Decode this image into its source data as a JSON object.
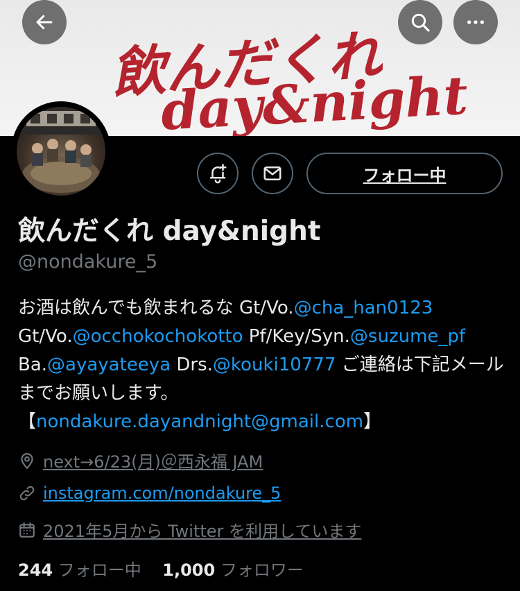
{
  "header": {
    "banner_line1": "飲んだくれ",
    "banner_line2": "day&night",
    "banner_color": "#b5242e",
    "back_icon": "arrow-left-icon",
    "search_icon": "search-icon",
    "more_icon": "more-horizontal-icon"
  },
  "actions": {
    "notify_icon": "bell-plus-icon",
    "message_icon": "envelope-icon",
    "follow_label": "フォロー中"
  },
  "profile": {
    "name": "飲んだくれ day&night",
    "handle": "@nondakure_5"
  },
  "bio": {
    "t1": "お酒は飲んでも飲まれるな Gt/Vo.",
    "m1": "@cha_han0123",
    "t2": " Gt/Vo.",
    "m2": "@occhokochokotto",
    "t3": " Pf/Key/Syn.",
    "m3": "@suzume_pf",
    "t4": " Ba.",
    "m4": "@ayayateeya",
    "t5": " Drs.",
    "m5": "@kouki10777",
    "t6": " ご連絡は下記メールまでお願いします。",
    "t7": "【",
    "email": "nondakure.dayandnight@gmail.com",
    "t8": "】"
  },
  "meta": {
    "location": "next→6/23(月)＠西永福 JAM",
    "website": "instagram.com/nondakure_5",
    "joined": "2021年5月から Twitter を利用しています"
  },
  "stats": {
    "following_count": "244",
    "following_label": "フォロー中",
    "followers_count": "1,000",
    "followers_label": "フォロワー"
  },
  "colors": {
    "link": "#1d9bf0",
    "muted": "#71767b",
    "text": "#e7e9ea"
  }
}
